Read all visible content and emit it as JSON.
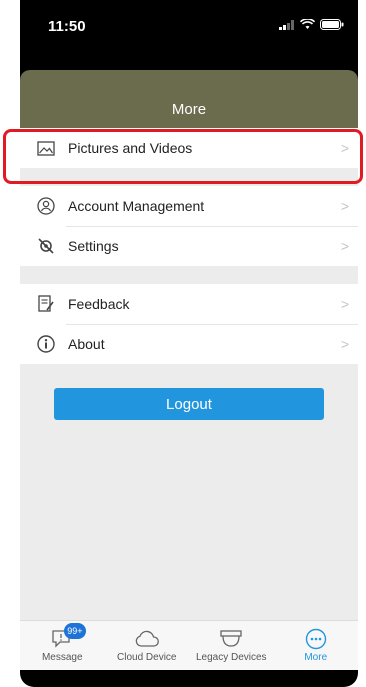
{
  "status_bar": {
    "time": "11:50"
  },
  "header": {
    "title": "More"
  },
  "menu": {
    "pictures_videos": "Pictures and Videos",
    "account_management": "Account Management",
    "settings": "Settings",
    "feedback": "Feedback",
    "about": "About",
    "chevron": ">"
  },
  "logout": {
    "label": "Logout"
  },
  "tabbar": {
    "message": "Message",
    "message_badge": "99+",
    "cloud_device": "Cloud Device",
    "legacy_devices": "Legacy Devices",
    "more": "More"
  },
  "colors": {
    "header": "#6b6b4e",
    "accent": "#2196de",
    "highlight": "#e01b24"
  }
}
